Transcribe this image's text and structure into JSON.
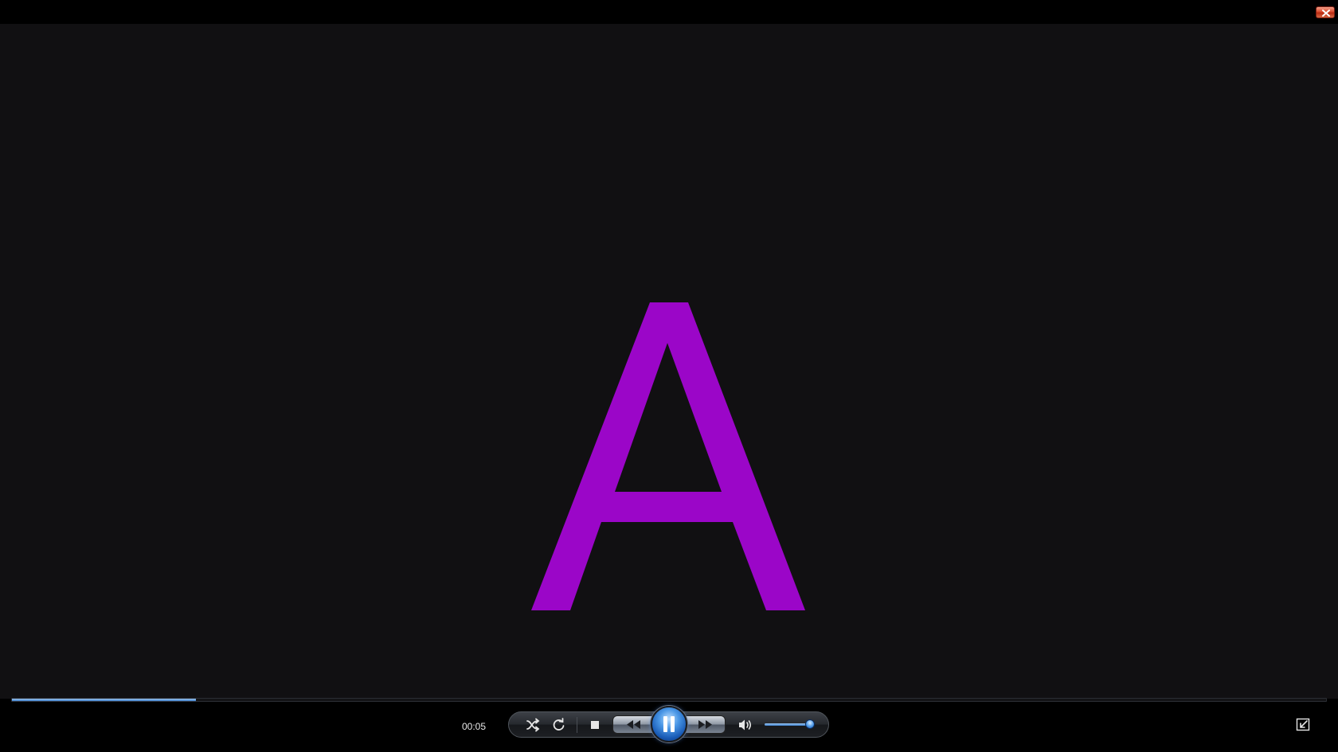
{
  "window": {
    "close_icon": "close-icon"
  },
  "video": {
    "frame_letter": "A",
    "letter_color": "#9b06c8",
    "background_color": "#111012"
  },
  "playback": {
    "time_elapsed": "00:05",
    "progress_fraction": 0.14,
    "state": "playing"
  },
  "volume": {
    "level_fraction": 0.92
  },
  "controls": [
    {
      "name": "shuffle",
      "icon": "shuffle-icon"
    },
    {
      "name": "repeat",
      "icon": "repeat-icon"
    },
    {
      "name": "stop",
      "icon": "stop-icon"
    },
    {
      "name": "previous",
      "icon": "rewind-icon"
    },
    {
      "name": "pause",
      "icon": "pause-icon"
    },
    {
      "name": "next",
      "icon": "fast-forward-icon"
    },
    {
      "name": "mute",
      "icon": "speaker-icon"
    },
    {
      "name": "exit-full-screen",
      "icon": "exit-fullscreen-icon"
    }
  ],
  "colors": {
    "accent": "#3a7cc8",
    "close_red": "#d84a2c"
  }
}
